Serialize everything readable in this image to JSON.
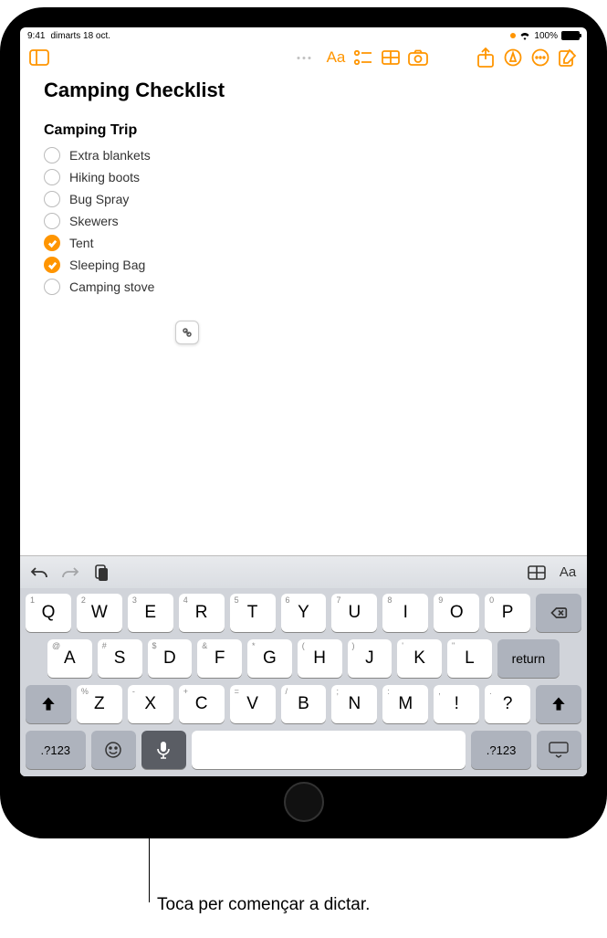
{
  "status": {
    "time": "9:41",
    "date": "dimarts 18 oct.",
    "battery": "100%"
  },
  "note": {
    "title": "Camping Checklist",
    "heading": "Camping Trip",
    "items": [
      {
        "label": "Extra blankets",
        "checked": false
      },
      {
        "label": "Hiking boots",
        "checked": false
      },
      {
        "label": "Bug Spray",
        "checked": false
      },
      {
        "label": "Skewers",
        "checked": false
      },
      {
        "label": "Tent",
        "checked": true
      },
      {
        "label": "Sleeping Bag",
        "checked": true
      },
      {
        "label": "Camping stove",
        "checked": false
      }
    ]
  },
  "keyboard": {
    "row1": [
      {
        "k": "Q",
        "s": "1"
      },
      {
        "k": "W",
        "s": "2"
      },
      {
        "k": "E",
        "s": "3"
      },
      {
        "k": "R",
        "s": "4"
      },
      {
        "k": "T",
        "s": "5"
      },
      {
        "k": "Y",
        "s": "6"
      },
      {
        "k": "U",
        "s": "7"
      },
      {
        "k": "I",
        "s": "8"
      },
      {
        "k": "O",
        "s": "9"
      },
      {
        "k": "P",
        "s": "0"
      }
    ],
    "row2": [
      {
        "k": "A",
        "s": "@"
      },
      {
        "k": "S",
        "s": "#"
      },
      {
        "k": "D",
        "s": "$"
      },
      {
        "k": "F",
        "s": "&"
      },
      {
        "k": "G",
        "s": "*"
      },
      {
        "k": "H",
        "s": "("
      },
      {
        "k": "J",
        "s": ")"
      },
      {
        "k": "K",
        "s": "'"
      },
      {
        "k": "L",
        "s": "\""
      }
    ],
    "row3": [
      {
        "k": "Z",
        "s": "%"
      },
      {
        "k": "X",
        "s": "-"
      },
      {
        "k": "C",
        "s": "+"
      },
      {
        "k": "V",
        "s": "="
      },
      {
        "k": "B",
        "s": "/"
      },
      {
        "k": "N",
        "s": ";"
      },
      {
        "k": "M",
        "s": ":"
      },
      {
        "k": "!",
        "s": ","
      },
      {
        "k": "?",
        "s": "."
      }
    ],
    "return": "return",
    "numbers": ".?123"
  },
  "caption": "Toca per començar a dictar."
}
